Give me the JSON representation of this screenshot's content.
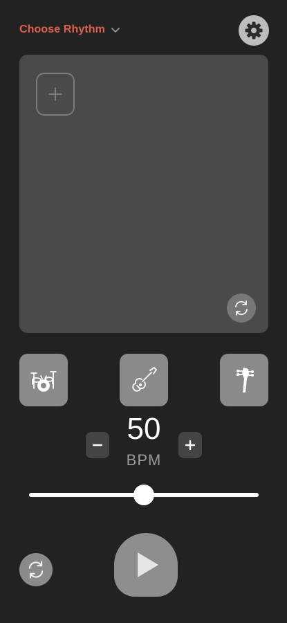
{
  "header": {
    "rhythm_selector_label": "Choose Rhythm",
    "rhythm_chevron_icon": "chevron-down-icon",
    "settings_icon": "gear-icon"
  },
  "panel": {
    "add_icon": "plus-icon",
    "refresh_icon": "refresh-icon"
  },
  "instruments": [
    {
      "name": "drums",
      "icon": "drum-kit-icon"
    },
    {
      "name": "guitar",
      "icon": "electric-guitar-icon"
    },
    {
      "name": "bass",
      "icon": "guitar-headstock-icon"
    }
  ],
  "tempo": {
    "value": "50",
    "unit": "BPM",
    "decrement_label": "−",
    "increment_label": "+",
    "slider_level": 0.5
  },
  "controls": {
    "refresh_icon": "refresh-icon",
    "play_icon": "play-icon"
  },
  "colors": {
    "background": "#222222",
    "accent": "#e0604e",
    "panel": "#4a4a4a",
    "button": "#8a8a8a"
  }
}
